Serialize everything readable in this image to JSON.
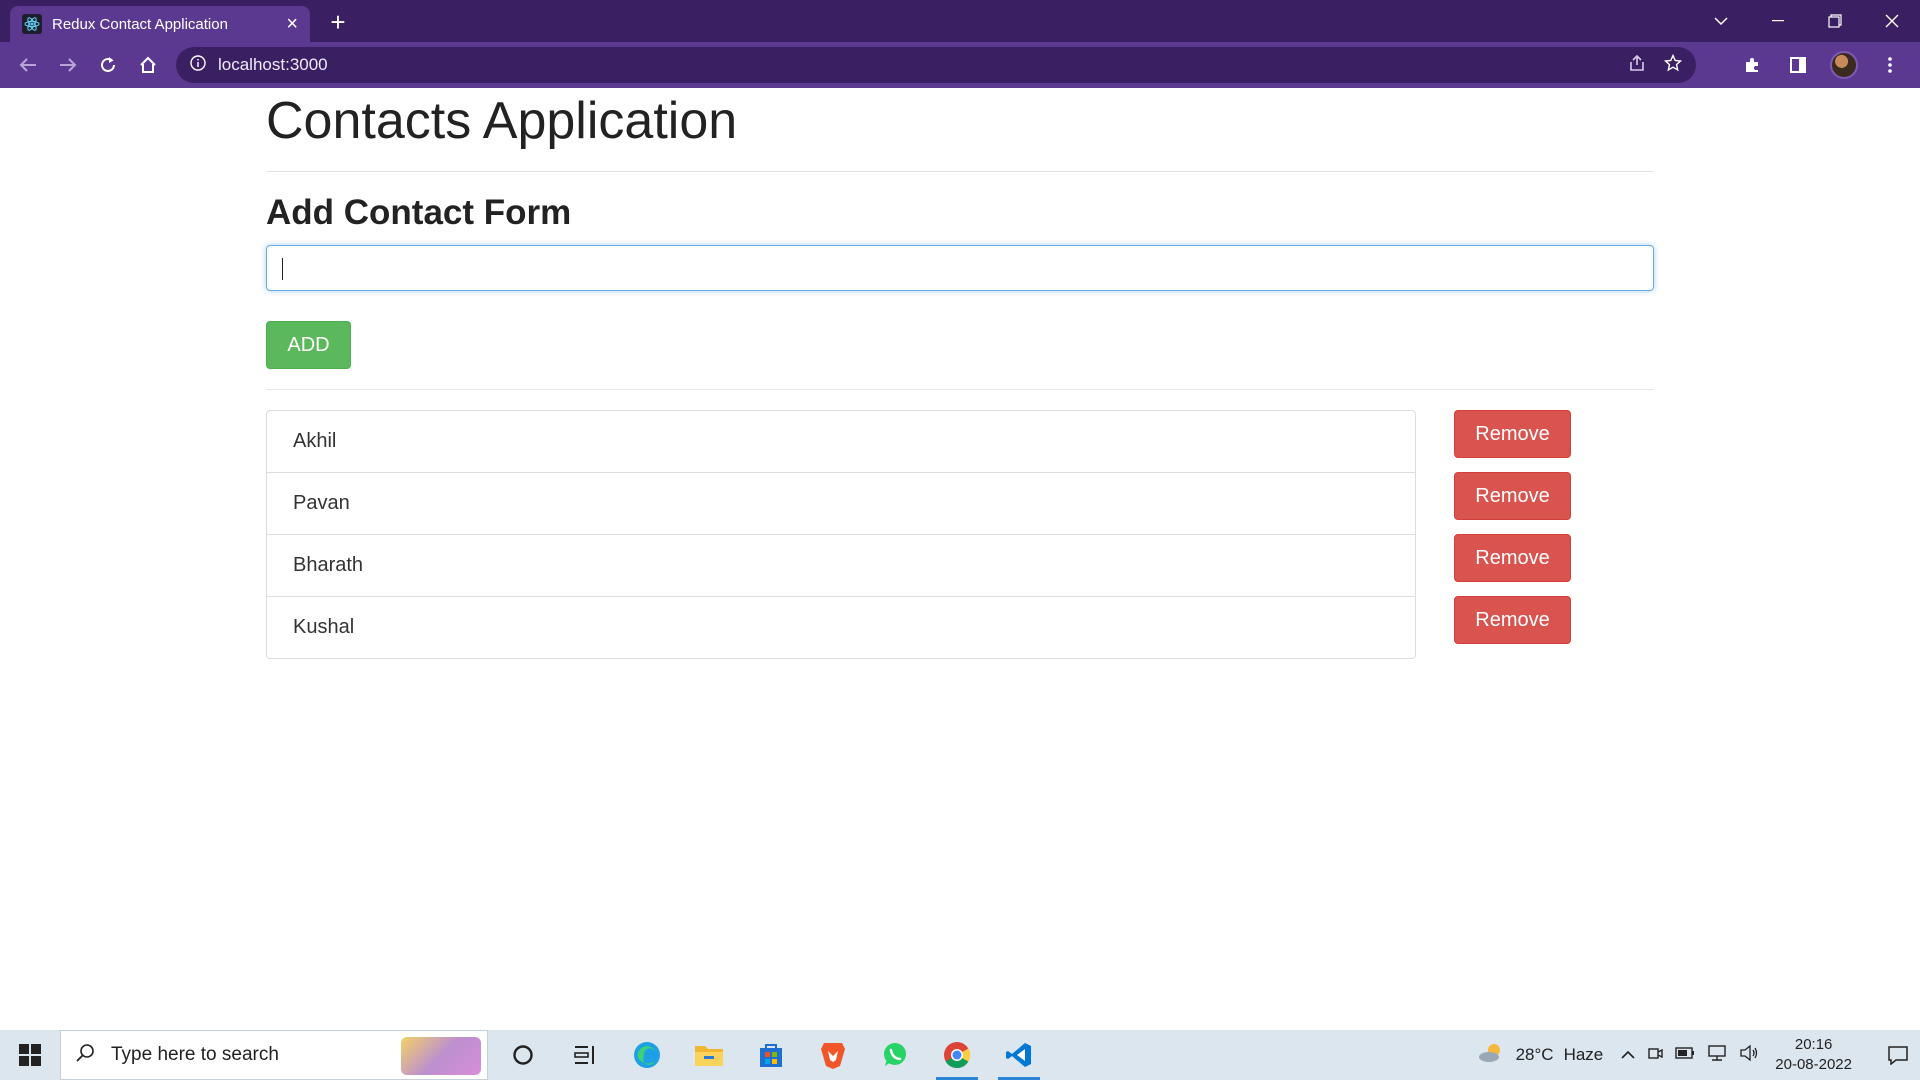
{
  "browser": {
    "tab_title": "Redux Contact Application",
    "url": "localhost:3000"
  },
  "page": {
    "title": "Contacts Application",
    "form_title": "Add Contact Form",
    "input_value": "",
    "add_button": "ADD",
    "remove_label": "Remove",
    "contacts": [
      "Akhil",
      "Pavan",
      "Bharath",
      "Kushal"
    ]
  },
  "taskbar": {
    "search_placeholder": "Type here to search",
    "weather_temp": "28°C",
    "weather_desc": "Haze",
    "time": "20:16",
    "date": "20-08-2022"
  },
  "colors": {
    "add_button": "#5cb85c",
    "remove_button": "#d9534f",
    "browser_frame": "#5b3990"
  }
}
